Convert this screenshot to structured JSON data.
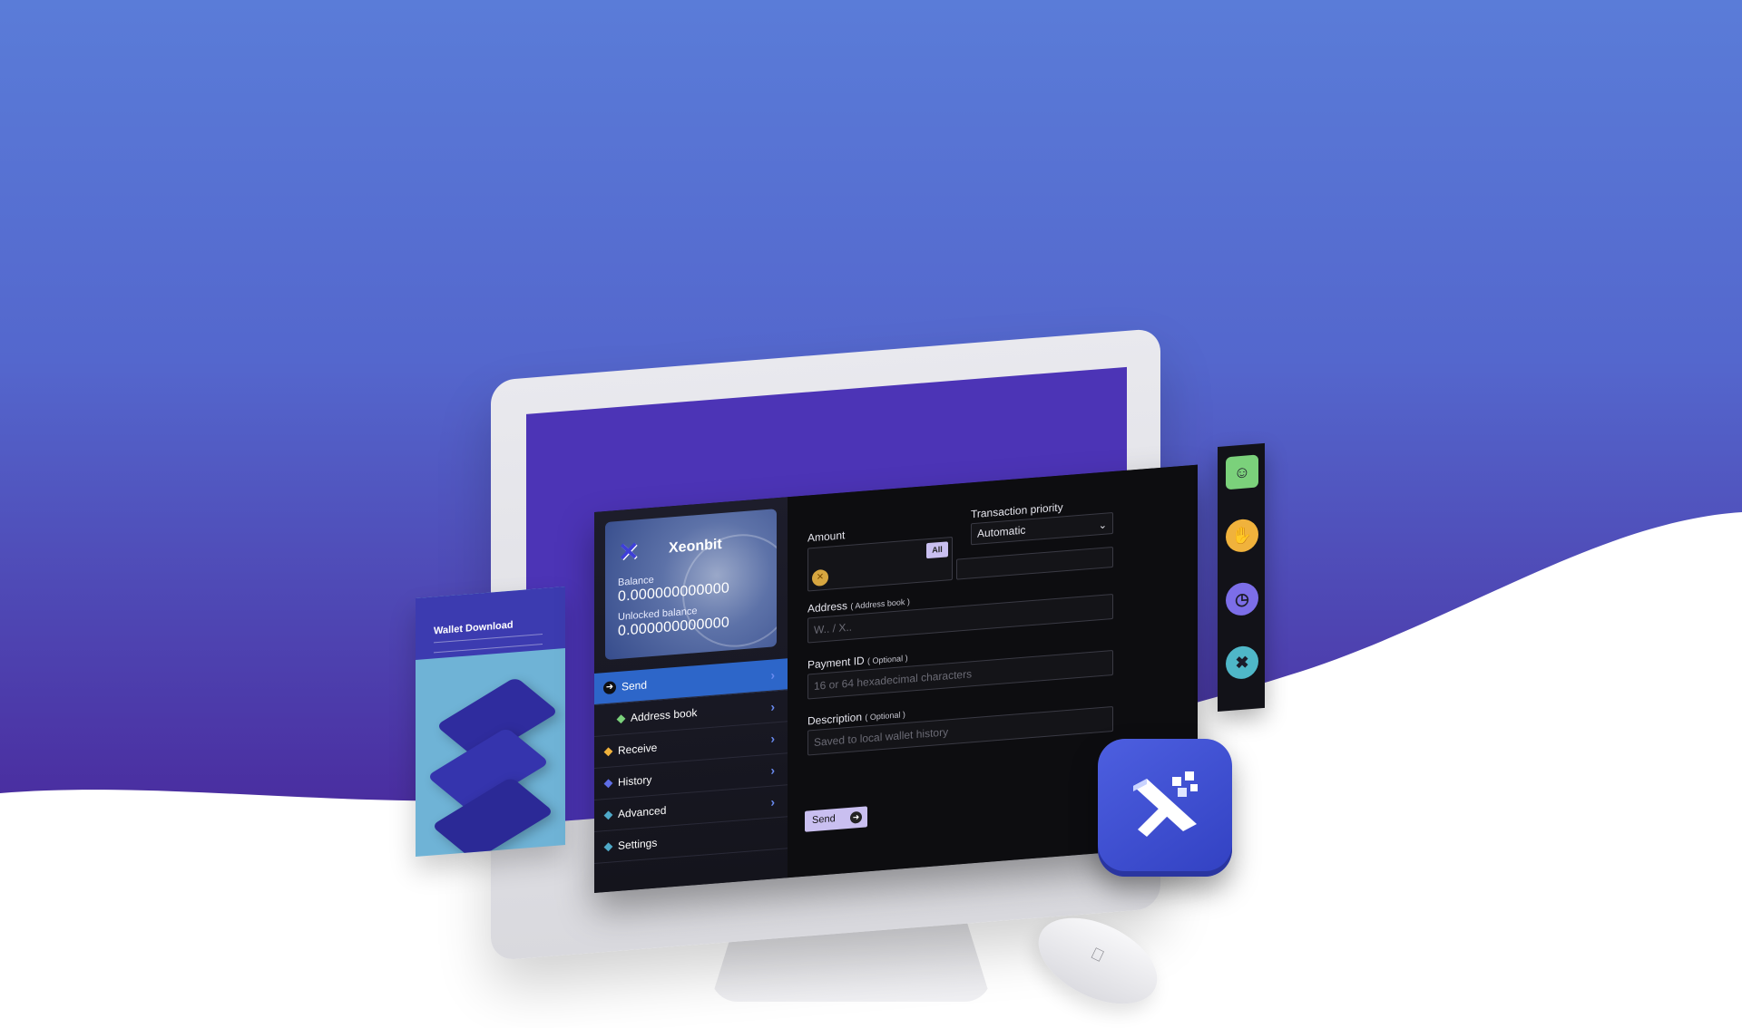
{
  "colors": {
    "background_top": "#5a7cd8",
    "background_bottom": "#4a2ea0",
    "accent": "#2d66c9",
    "button": "#c9bff0",
    "app_background": "#0d0d10"
  },
  "phone_panel": {
    "title": "Wallet Download"
  },
  "wallet_card": {
    "brand": "Xeonbit",
    "balance_label": "Balance",
    "balance_value": "0.000000000000",
    "unlocked_label": "Unlocked balance",
    "unlocked_value": "0.000000000000"
  },
  "sidebar": {
    "items": [
      {
        "label": "Send",
        "icon": "arrow-right-icon",
        "active": true
      },
      {
        "label": "Address book",
        "icon": "diamond-icon",
        "color": "#7bd17b",
        "sub": true
      },
      {
        "label": "Receive",
        "icon": "diamond-icon",
        "color": "#f0b23c"
      },
      {
        "label": "History",
        "icon": "diamond-icon",
        "color": "#5f6ee6"
      },
      {
        "label": "Advanced",
        "icon": "diamond-icon",
        "color": "#4fa9c8"
      },
      {
        "label": "Settings",
        "icon": "diamond-icon",
        "color": "#4fa9c8"
      }
    ]
  },
  "send_form": {
    "amount_label": "Amount",
    "all_button": "All",
    "priority_label": "Transaction priority",
    "priority_value": "Automatic",
    "address_label": "Address",
    "address_link": "( Address book )",
    "address_placeholder": "W.. / X..",
    "payment_id_label": "Payment ID",
    "payment_id_note": "( Optional )",
    "payment_id_placeholder": "16 or 64 hexadecimal characters",
    "description_label": "Description",
    "description_note": "( Optional )",
    "description_placeholder": "Saved to local wallet history",
    "send_button": "Send"
  },
  "icon_strip": {
    "icons": [
      {
        "name": "address-book-icon",
        "color": "#7bd17b"
      },
      {
        "name": "receive-coin-icon",
        "color": "#f0b23c"
      },
      {
        "name": "history-clock-icon",
        "color": "#7c6ee8"
      },
      {
        "name": "tools-icon",
        "color": "#4fb7c8"
      }
    ]
  }
}
